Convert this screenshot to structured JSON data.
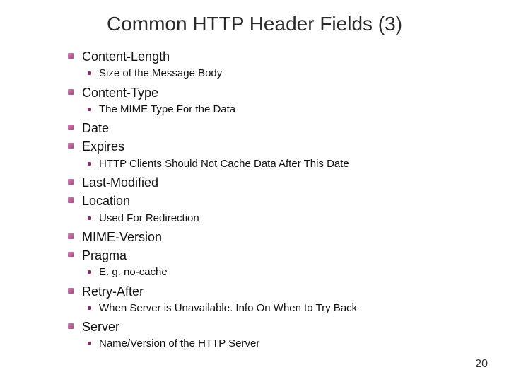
{
  "title": "Common HTTP Header Fields (3)",
  "items": [
    {
      "label": "Content-Length",
      "sub": [
        "Size of the Message Body"
      ]
    },
    {
      "label": "Content-Type",
      "sub": [
        "The MIME Type For the Data"
      ]
    },
    {
      "label": "Date",
      "sub": []
    },
    {
      "label": "Expires",
      "sub": [
        "HTTP Clients Should Not Cache Data After This Date"
      ]
    },
    {
      "label": "Last-Modified",
      "sub": []
    },
    {
      "label": "Location",
      "sub": [
        "Used For Redirection"
      ]
    },
    {
      "label": "MIME-Version",
      "sub": []
    },
    {
      "label": "Pragma",
      "sub": [
        "E. g. no-cache"
      ]
    },
    {
      "label": "Retry-After",
      "sub": [
        "When Server is Unavailable.  Info On When to Try Back"
      ]
    },
    {
      "label": "Server",
      "sub": [
        "Name/Version of the HTTP Server"
      ]
    }
  ],
  "page_number": "20"
}
